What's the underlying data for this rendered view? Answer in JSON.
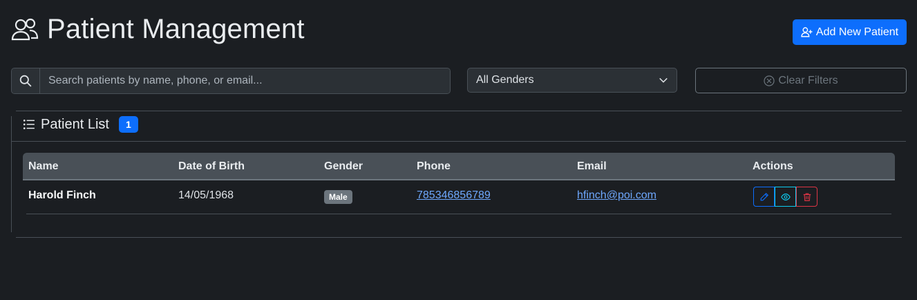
{
  "header": {
    "title": "Patient Management",
    "add_button_label": "Add New Patient"
  },
  "filters": {
    "search_placeholder": "Search patients by name, phone, or email...",
    "gender_selected": "All Genders",
    "clear_label": "Clear Filters"
  },
  "card": {
    "title": "Patient List",
    "count": "1"
  },
  "table": {
    "columns": [
      "Name",
      "Date of Birth",
      "Gender",
      "Phone",
      "Email",
      "Actions"
    ],
    "rows": [
      {
        "name": "Harold Finch",
        "dob": "14/05/1968",
        "gender": "Male",
        "phone": "785346856789",
        "email": "hfinch@poi.com"
      }
    ]
  },
  "colors": {
    "background": "#1b1e22",
    "primary": "#0d6efd",
    "info": "#0dcaf0",
    "danger": "#dc3545",
    "link": "#6ea8fe"
  },
  "icons": {
    "title_icon": "people-icon",
    "add_icon": "person-plus-icon",
    "search_icon": "search-icon",
    "select_icon": "chevron-down-icon",
    "clear_icon": "x-circle-icon",
    "list_icon": "list-icon",
    "edit_icon": "pencil-icon",
    "view_icon": "eye-icon",
    "delete_icon": "trash-icon"
  }
}
